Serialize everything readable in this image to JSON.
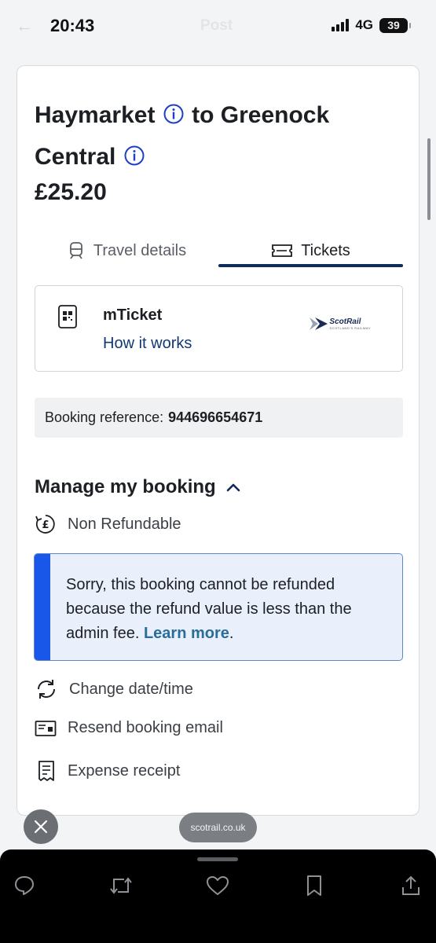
{
  "status_bar": {
    "time": "20:43",
    "ghost_title": "Post",
    "network": "4G",
    "battery": "39"
  },
  "booking": {
    "title_origin": "Haymarket",
    "title_to": "to Greenock",
    "title_destination": "Central",
    "price": "£25.20",
    "tabs": [
      {
        "label": "Travel details",
        "icon": "train-icon",
        "active": false
      },
      {
        "label": "Tickets",
        "icon": "ticket-icon",
        "active": true
      }
    ],
    "ticket": {
      "name": "mTicket",
      "link": "How it works",
      "logo_text": "ScotRail",
      "logo_sub": "SCOTLAND'S RAILWAY"
    },
    "reference_label": "Booking reference:",
    "reference_number": "944696654671",
    "manage_title": "Manage my booking",
    "refund_status": "Non Refundable",
    "alert_text": "Sorry, this booking cannot be refunded because the refund value is less than the admin fee.",
    "alert_link": "Learn more",
    "alert_after": ".",
    "actions": [
      {
        "label": "Change date/time",
        "icon": "refresh-icon"
      },
      {
        "label": "Resend booking email",
        "icon": "email-icon"
      },
      {
        "label": "Expense receipt",
        "icon": "receipt-icon"
      }
    ]
  },
  "browser": {
    "url": "scotrail.co.uk"
  },
  "colors": {
    "accent_navy": "#0f2b5b",
    "alert_blue": "#1957e8",
    "alert_bg": "#e9f0fb",
    "link_blue": "#12396f",
    "info_icon": "#1d3fc9"
  }
}
